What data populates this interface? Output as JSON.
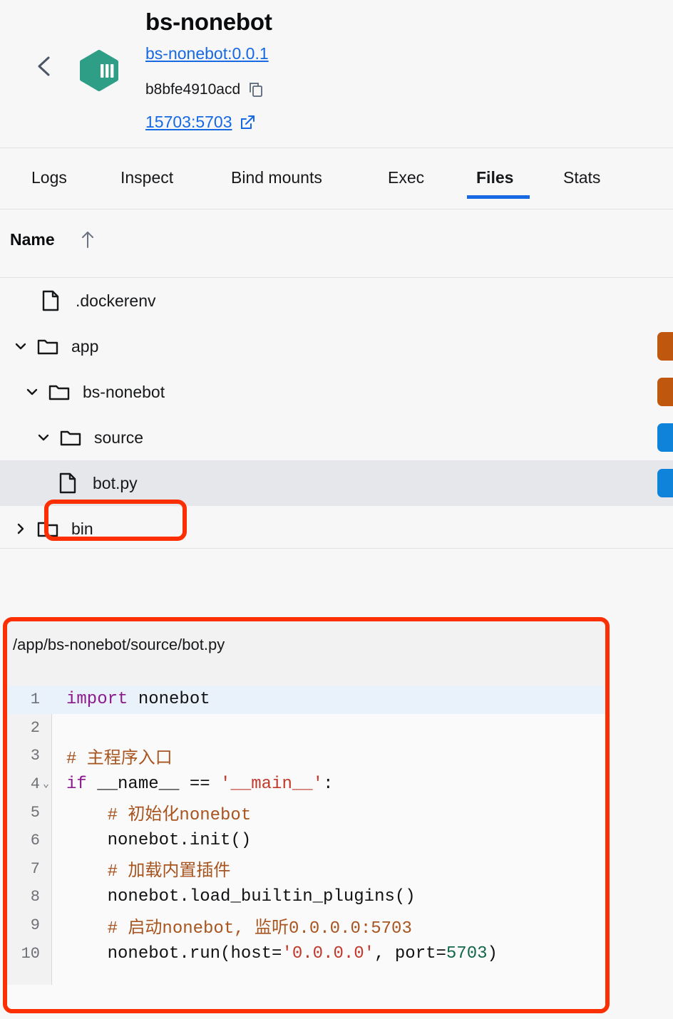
{
  "header": {
    "back_icon": "chevron-left-icon",
    "container_icon": "docker-container-icon",
    "title": "bs-nonebot",
    "image_link": "bs-nonebot:0.0.1",
    "container_id": "b8bfe4910acd",
    "copy_icon": "copy-icon",
    "port_link": "15703:5703",
    "external_link_icon": "external-link-icon",
    "link_color": "#1668e3",
    "container_icon_color": "#2e9e86"
  },
  "tabs": {
    "items": [
      {
        "label": "Logs",
        "active": false
      },
      {
        "label": "Inspect",
        "active": false
      },
      {
        "label": "Bind mounts",
        "active": false
      },
      {
        "label": "Exec",
        "active": false
      },
      {
        "label": "Files",
        "active": true
      },
      {
        "label": "Stats",
        "active": false
      }
    ],
    "active_underline_color": "#1668e3"
  },
  "file_table": {
    "column_header": "Name",
    "sort_icon": "arrow-up-icon",
    "rows": [
      {
        "name": ".dockerenv",
        "type": "file",
        "depth": 0,
        "expanded": null,
        "selected": false,
        "badge": null
      },
      {
        "name": "app",
        "type": "folder",
        "depth": 0,
        "expanded": true,
        "selected": false,
        "badge": "#c0570f"
      },
      {
        "name": "bs-nonebot",
        "type": "folder",
        "depth": 1,
        "expanded": true,
        "selected": false,
        "badge": "#c0570f"
      },
      {
        "name": "source",
        "type": "folder",
        "depth": 2,
        "expanded": true,
        "selected": false,
        "badge": "#0f83d9"
      },
      {
        "name": "bot.py",
        "type": "file",
        "depth": 3,
        "expanded": null,
        "selected": true,
        "badge": "#0f83d9"
      },
      {
        "name": "bin",
        "type": "folder",
        "depth": 0,
        "expanded": false,
        "selected": false,
        "badge": null
      }
    ],
    "annotation_color": "#fb2f01"
  },
  "code_viewer": {
    "path": "/app/bs-nonebot/source/bot.py",
    "annotation_color": "#fb2f01",
    "highlighted_line": 1,
    "fold_lines": [
      4
    ],
    "lines": [
      {
        "n": 1,
        "tokens": [
          {
            "t": "import",
            "c": "kw"
          },
          {
            "t": " nonebot",
            "c": ""
          }
        ]
      },
      {
        "n": 2,
        "tokens": []
      },
      {
        "n": 3,
        "tokens": [
          {
            "t": "# 主程序入口",
            "c": "cmt"
          }
        ]
      },
      {
        "n": 4,
        "tokens": [
          {
            "t": "if",
            "c": "kw"
          },
          {
            "t": " __name__ == ",
            "c": ""
          },
          {
            "t": "'__main__'",
            "c": "str"
          },
          {
            "t": ":",
            "c": ""
          }
        ]
      },
      {
        "n": 5,
        "tokens": [
          {
            "t": "    # 初始化nonebot",
            "c": "cmt"
          }
        ]
      },
      {
        "n": 6,
        "tokens": [
          {
            "t": "    nonebot.init()",
            "c": ""
          }
        ]
      },
      {
        "n": 7,
        "tokens": [
          {
            "t": "    # 加载内置插件",
            "c": "cmt"
          }
        ]
      },
      {
        "n": 8,
        "tokens": [
          {
            "t": "    nonebot.load_builtin_plugins()",
            "c": ""
          }
        ]
      },
      {
        "n": 9,
        "tokens": [
          {
            "t": "    # 启动nonebot, 监听0.0.0.0:5703",
            "c": "cmt"
          }
        ]
      },
      {
        "n": 10,
        "tokens": [
          {
            "t": "    nonebot.run(host=",
            "c": ""
          },
          {
            "t": "'0.0.0.0'",
            "c": "str"
          },
          {
            "t": ", port=",
            "c": ""
          },
          {
            "t": "5703",
            "c": "num"
          },
          {
            "t": ")",
            "c": ""
          }
        ]
      }
    ]
  }
}
